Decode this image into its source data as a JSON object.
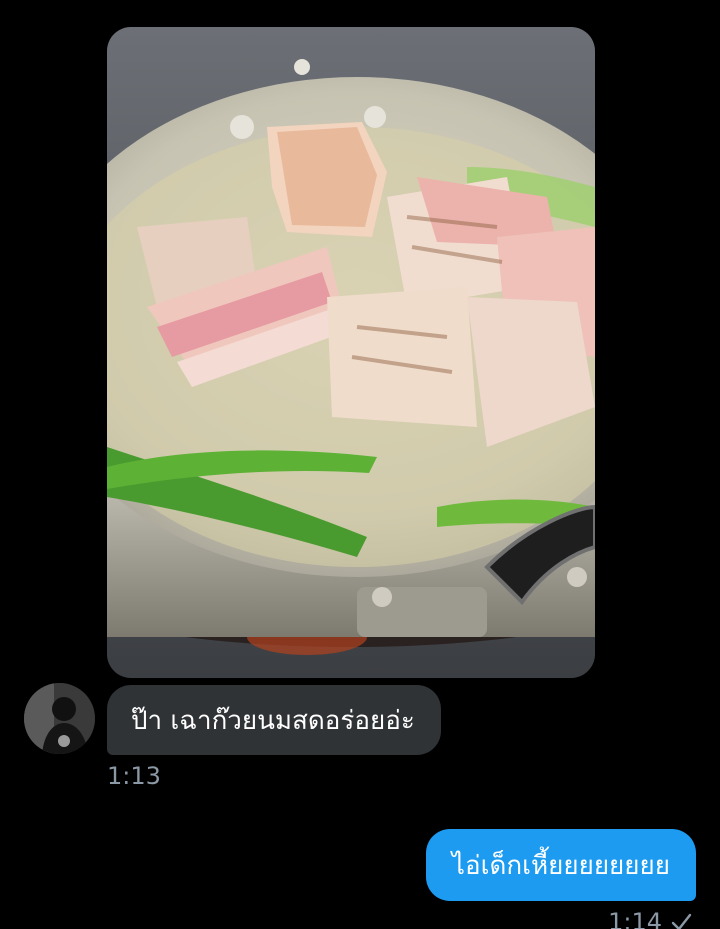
{
  "conversation": {
    "photo_message": {
      "image_icon": "photo-of-grilled-pork-pan"
    },
    "incoming_message": {
      "text": "ป๊า เฉาก๊วยนมสดอร่อยอ่ะ",
      "time": "1:13",
      "avatar_icon": "user-avatar"
    },
    "outgoing_message": {
      "text": "ไอ่เด็กเหี้ยยยยยยยย",
      "time": "1:14",
      "status_icon": "check-icon"
    }
  },
  "colors": {
    "background": "#000000",
    "incoming_bubble": "#2f3336",
    "outgoing_bubble": "#1d9bf0",
    "timestamp": "#8b98a5"
  }
}
